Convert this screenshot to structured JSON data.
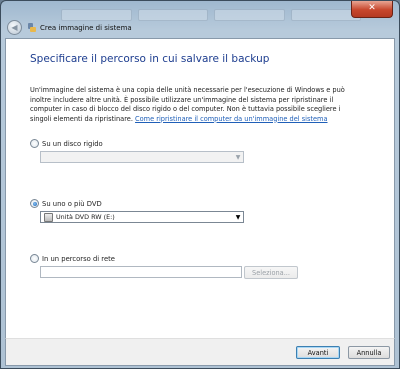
{
  "window": {
    "title": "Crea immagine di sistema",
    "close_glyph": "✕"
  },
  "icons": {
    "back": "back-arrow-icon",
    "app": "backup-restore-icon",
    "dvd": "dvd-drive-icon",
    "dropdown": "chevron-down-icon"
  },
  "main": {
    "heading": "Specificare il percorso in cui salvare il backup",
    "description": "Un'immagine del sistema è una copia delle unità necessarie per l'esecuzione di Windows e può inoltre includere altre unità. È possibile utilizzare un'immagine del sistema per ripristinare il computer in caso di blocco del disco rigido o del computer. Non è tuttavia possibile scegliere i singoli elementi da ripristinare.",
    "help_link": "Come ripristinare il computer da un'immagine del sistema"
  },
  "options": {
    "hard_disk": {
      "label": "Su un disco rigido",
      "checked": false,
      "value": ""
    },
    "dvd": {
      "label": "Su uno o più DVD",
      "checked": true,
      "value": "Unità DVD RW (E:)"
    },
    "network": {
      "label": "In un percorso di rete",
      "checked": false,
      "value": "",
      "browse_label": "Seleziona..."
    }
  },
  "footer": {
    "next_label": "Avanti",
    "cancel_label": "Annulla"
  },
  "colors": {
    "heading": "#1d3d8f",
    "link": "#1f5fb8",
    "close_button": "#c7472d"
  }
}
